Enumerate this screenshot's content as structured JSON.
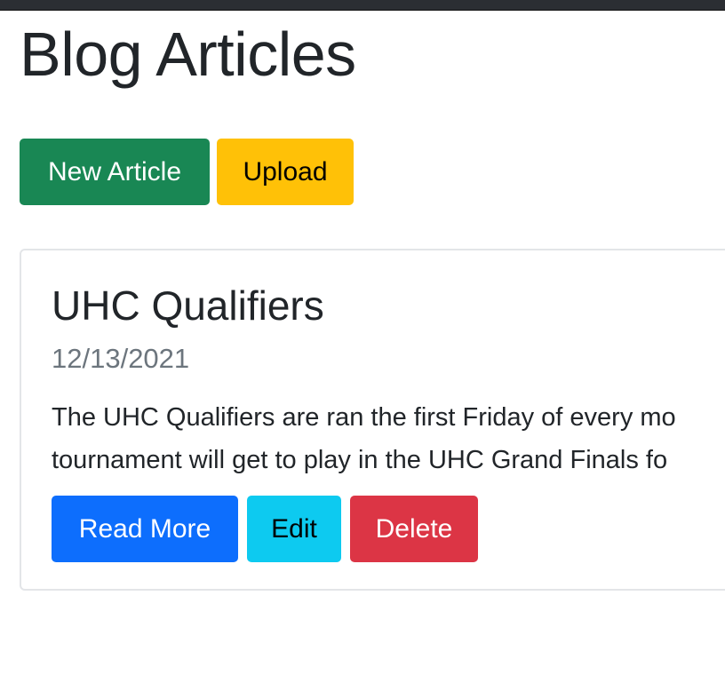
{
  "page": {
    "title": "Blog Articles"
  },
  "toolbar": {
    "new_article_label": "New Article",
    "upload_label": "Upload"
  },
  "articles": [
    {
      "title": "UHC Qualifiers",
      "date": "12/13/2021",
      "excerpt_lines": [
        "The UHC Qualifiers are ran the first Friday of every mo",
        "tournament will get to play in the UHC Grand Finals fo"
      ],
      "read_more_label": "Read More",
      "edit_label": "Edit",
      "delete_label": "Delete"
    }
  ],
  "colors": {
    "success": "#198754",
    "warning": "#ffc107",
    "primary": "#0d6efd",
    "info": "#0dcaf0",
    "danger": "#dc3545",
    "muted": "#6c757d"
  }
}
